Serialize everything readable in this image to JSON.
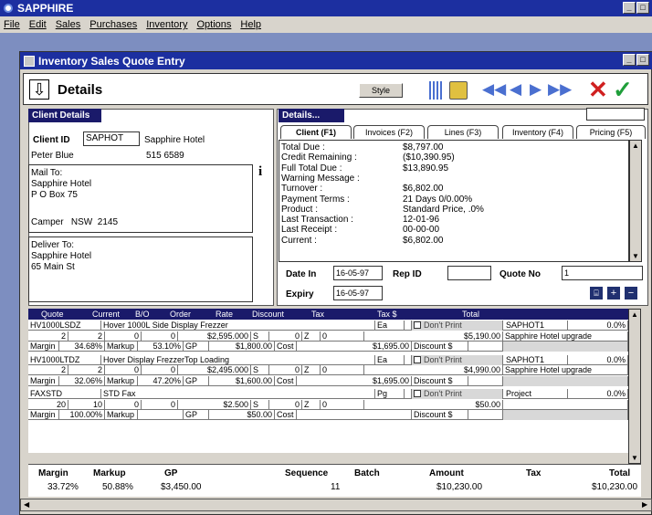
{
  "app": {
    "title": "SAPPHIRE"
  },
  "menu": [
    "File",
    "Edit",
    "Sales",
    "Purchases",
    "Inventory",
    "Options",
    "Help"
  ],
  "child_window": {
    "title": "Inventory Sales Quote Entry"
  },
  "toolbar": {
    "heading": "Details",
    "style_label": "Style"
  },
  "client_details": {
    "header": "Client Details",
    "client_id_label": "Client ID",
    "client_id": "SAPHOT",
    "client_name": "Sapphire Hotel",
    "contact": "Peter Blue",
    "phone": "515 6589",
    "mail_to_label": "Mail To:",
    "mail_line1": "Sapphire Hotel",
    "mail_line2": "P O Box 75",
    "mail_city": "Camper   NSW  2145",
    "deliver_to_label": "Deliver To:",
    "deliver_line1": "Sapphire Hotel",
    "deliver_line2": "65 Main St"
  },
  "details": {
    "header": "Details...",
    "tabs": [
      "Client (F1)",
      "Invoices (F2)",
      "Lines (F3)",
      "Inventory (F4)",
      "Pricing (F5)"
    ],
    "rows": [
      {
        "label": "Total Due :",
        "value": "$8,797.00"
      },
      {
        "label": "Credit Remaining :",
        "value": "($10,390.95)"
      },
      {
        "label": "Full Total Due :",
        "value": "$13,890.95"
      },
      {
        "label": "Warning Message :",
        "value": ""
      },
      {
        "label": "Turnover :",
        "value": "$6,802.00"
      },
      {
        "label": "Payment Terms :",
        "value": "21 Days 0/0.00%"
      },
      {
        "label": "Product :",
        "value": "Standard Price, .0%"
      },
      {
        "label": "Last Transaction :",
        "value": "12-01-96"
      },
      {
        "label": "Last Receipt :",
        "value": "00-00-00"
      },
      {
        "label": "Current :",
        "value": "$6,802.00"
      }
    ]
  },
  "quote": {
    "date_in_label": "Date In",
    "date_in": "16-05-97",
    "rep_id_label": "Rep ID",
    "rep_id": "",
    "quote_no_label": "Quote No",
    "quote_no": "1",
    "expiry_label": "Expiry",
    "expiry": "16-05-97"
  },
  "grid": {
    "headers": [
      "Quote",
      "Current",
      "B/O",
      "Order",
      "Rate",
      "Discount",
      "Tax",
      "Tax $",
      "Total"
    ],
    "lines": [
      {
        "code": "HV1000LSDZ",
        "desc": "Hover 1000L Side Display Frezzer",
        "unit": "Ea",
        "dont_print": "Don't Print",
        "client": "SAPHOT1",
        "pct": "0.0%",
        "quote": "2",
        "current": "2",
        "bo": "0",
        "order": "0",
        "rate": "$2,595.000",
        "tax_code": "S",
        "disc": "0",
        "z": "Z",
        "tax_amt": "0",
        "total": "$5,190.00",
        "note": "Sapphire Hotel upgrade",
        "margin_label": "Margin",
        "margin": "34.68%",
        "markup_label": "Markup",
        "markup": "53.10%",
        "gp_label": "GP",
        "gp": "$1,800.00",
        "cost_label": "Cost",
        "cost": "$1,695.00",
        "discount_label": "Discount $"
      },
      {
        "code": "HV1000LTDZ",
        "desc": "Hover Display FrezzerTop Loading",
        "unit": "Ea",
        "dont_print": "Don't Print",
        "client": "SAPHOT1",
        "pct": "0.0%",
        "quote": "2",
        "current": "2",
        "bo": "0",
        "order": "0",
        "rate": "$2,495.000",
        "tax_code": "S",
        "disc": "0",
        "z": "Z",
        "tax_amt": "0",
        "total": "$4,990.00",
        "note": "Sapphire Hotel upgrade",
        "margin_label": "Margin",
        "margin": "32.06%",
        "markup_label": "Markup",
        "markup": "47.20%",
        "gp_label": "GP",
        "gp": "$1,600.00",
        "cost_label": "Cost",
        "cost": "$1,695.00",
        "discount_label": "Discount $"
      },
      {
        "code": "FAXSTD",
        "desc": "STD Fax",
        "unit": "Pg",
        "dont_print": "Don't Print",
        "client": "Project",
        "pct": "0.0%",
        "quote": "20",
        "current": "10",
        "bo": "0",
        "order": "0",
        "rate": "$2.500",
        "tax_code": "S",
        "disc": "0",
        "z": "Z",
        "tax_amt": "0",
        "total": "$50.00",
        "note": "",
        "margin_label": "Margin",
        "margin": "100.00%",
        "markup_label": "Markup",
        "markup": "",
        "gp_label": "GP",
        "gp": "$50.00",
        "cost_label": "Cost",
        "cost": "",
        "discount_label": "Discount $"
      }
    ]
  },
  "totals": {
    "margin_label": "Margin",
    "margin": "33.72%",
    "markup_label": "Markup",
    "markup": "50.88%",
    "gp_label": "GP",
    "gp": "$3,450.00",
    "sequence_label": "Sequence",
    "sequence": "11",
    "batch_label": "Batch",
    "batch": "",
    "amount_label": "Amount",
    "amount": "$10,230.00",
    "tax_label": "Tax",
    "tax": "",
    "total_label": "Total",
    "total": "$10,230.00"
  },
  "colors": {
    "title_bar": "#1c2fa0",
    "header_bar": "#1a1a6a",
    "panel_gray": "#d8d4cc",
    "accept": "#1f9e3a",
    "cancel": "#d02020",
    "nav_arrows": "#4a6fd0"
  }
}
